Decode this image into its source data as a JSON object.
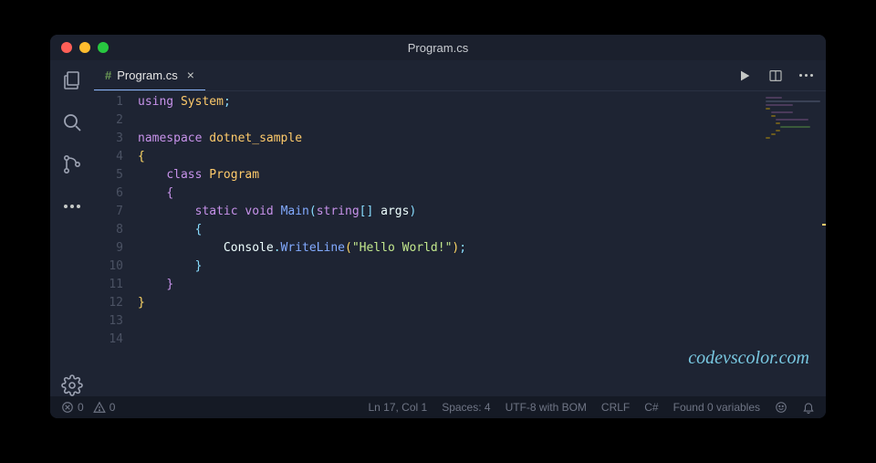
{
  "titlebar": {
    "title": "Program.cs"
  },
  "tab": {
    "filename": "Program.cs",
    "close": "×",
    "prefix": "#"
  },
  "toolbar": {
    "run": "▶"
  },
  "code": {
    "lines": [
      {
        "n": 1,
        "html": "<span class='tok-kw'>using</span> <span class='tok-ns'>System</span><span class='tok-semi'>;</span>"
      },
      {
        "n": 2,
        "html": ""
      },
      {
        "n": 3,
        "html": "<span class='tok-kw'>namespace</span> <span class='tok-ns'>dotnet_sample</span>"
      },
      {
        "n": 4,
        "html": "<span class='tok-brace'>{</span>"
      },
      {
        "n": 5,
        "html": "    <span class='tok-kw'>class</span> <span class='tok-type'>Program</span>"
      },
      {
        "n": 6,
        "html": "    <span class='tok-brace2'>{</span>"
      },
      {
        "n": 7,
        "html": "        <span class='tok-kw'>static</span> <span class='tok-kw'>void</span> <span class='tok-fn'>Main</span><span class='tok-brace3'>(</span><span class='tok-kw'>string</span><span class='tok-punc'>[]</span> <span class='tok-ident'>args</span><span class='tok-brace3'>)</span>"
      },
      {
        "n": 8,
        "html": "        <span class='tok-brace3'>{</span>"
      },
      {
        "n": 9,
        "html": "            <span class='tok-ident'>Console</span><span class='tok-punc'>.</span><span class='tok-fn'>WriteLine</span><span class='tok-brace'>(</span><span class='tok-str'>\"Hello World!\"</span><span class='tok-brace'>)</span><span class='tok-semi'>;</span>"
      },
      {
        "n": 10,
        "html": "        <span class='tok-brace3'>}</span>"
      },
      {
        "n": 11,
        "html": "    <span class='tok-brace2'>}</span>"
      },
      {
        "n": 12,
        "html": "<span class='tok-brace'>}</span>"
      },
      {
        "n": 13,
        "html": ""
      },
      {
        "n": 14,
        "html": ""
      }
    ]
  },
  "statusbar": {
    "errors": "0",
    "warnings": "0",
    "cursor": "Ln 17, Col 1",
    "spaces": "Spaces: 4",
    "encoding": "UTF-8 with BOM",
    "eol": "CRLF",
    "lang": "C#",
    "variables": "Found 0 variables"
  },
  "watermark": "codevscolor.com"
}
